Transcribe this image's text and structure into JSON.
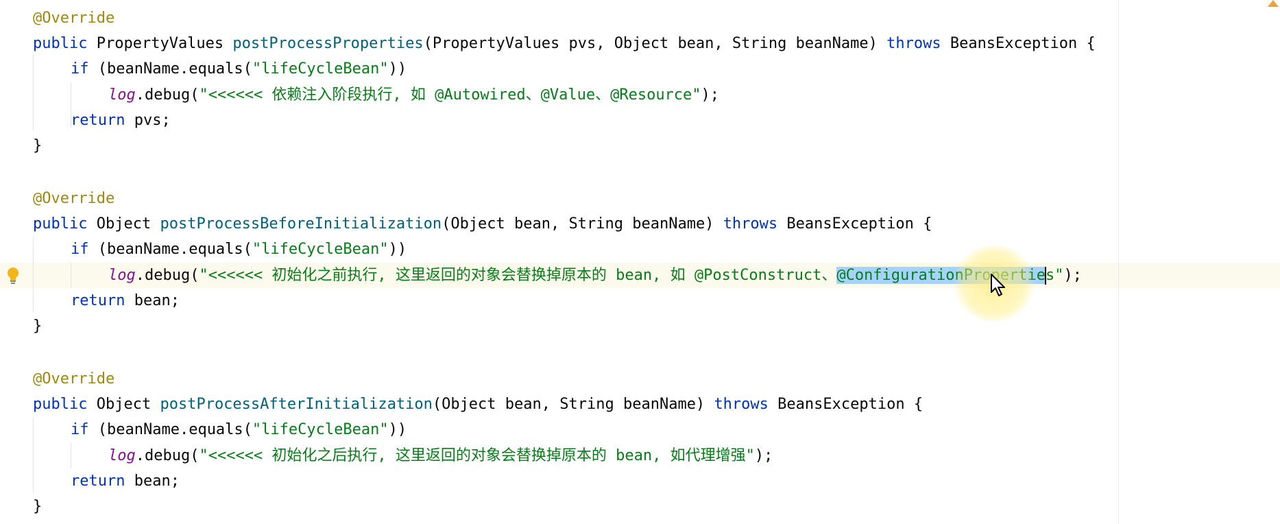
{
  "editor": {
    "blocks": [
      {
        "annotation": "@Override",
        "sig_public": "public",
        "sig_return": "PropertyValues",
        "sig_method": "postProcessProperties",
        "sig_params": "(PropertyValues pvs, Object bean, String beanName)",
        "sig_throws": "throws",
        "sig_exception": "BeansException {",
        "if_kw": "if",
        "if_head": "(beanName.equals(",
        "if_str": "\"lifeCycleBean\"",
        "if_tail": "))",
        "log_field": "log",
        "log_call": ".debug(",
        "log_msg": "\"<<<<<< 依赖注入阶段执行, 如 @Autowired、@Value、@Resource\"",
        "log_end": ");",
        "ret_kw": "return",
        "ret_val": "pvs;",
        "close": "}"
      },
      {
        "annotation": "@Override",
        "sig_public": "public",
        "sig_return": "Object",
        "sig_method": "postProcessBeforeInitialization",
        "sig_params": "(Object bean, String beanName)",
        "sig_throws": "throws",
        "sig_exception": "BeansException {",
        "if_kw": "if",
        "if_head": "(beanName.equals(",
        "if_str": "\"lifeCycleBean\"",
        "if_tail": "))",
        "log_field": "log",
        "log_call": ".debug(",
        "log_msg_pre": "\"<<<<<< 初始化之前执行, 这里返回的对象会替换掉原本的 bean, 如 @PostConstruct、",
        "log_msg_selected": "@ConfigurationPropertie",
        "log_msg_post": "s\"",
        "log_end": ");",
        "ret_kw": "return",
        "ret_val": "bean;",
        "close": "}"
      },
      {
        "annotation": "@Override",
        "sig_public": "public",
        "sig_return": "Object",
        "sig_method": "postProcessAfterInitialization",
        "sig_params": "(Object bean, String beanName)",
        "sig_throws": "throws",
        "sig_exception": "BeansException {",
        "if_kw": "if",
        "if_head": "(beanName.equals(",
        "if_str": "\"lifeCycleBean\"",
        "if_tail": "))",
        "log_field": "log",
        "log_call": ".debug(",
        "log_msg": "\"<<<<<< 初始化之后执行, 这里返回的对象会替换掉原本的 bean, 如代理增强\"",
        "log_end": ");",
        "ret_kw": "return",
        "ret_val": "bean;",
        "close": "}"
      }
    ]
  },
  "icons": {
    "intention": "lightbulb-icon",
    "pointer": "mouse-cursor-icon"
  },
  "colors": {
    "keyword": "#0033b3",
    "annotation": "#9e880d",
    "method": "#00627a",
    "string": "#067d17",
    "field": "#871094",
    "selection": "#a6d2ff",
    "current_line": "#fcfaed"
  }
}
